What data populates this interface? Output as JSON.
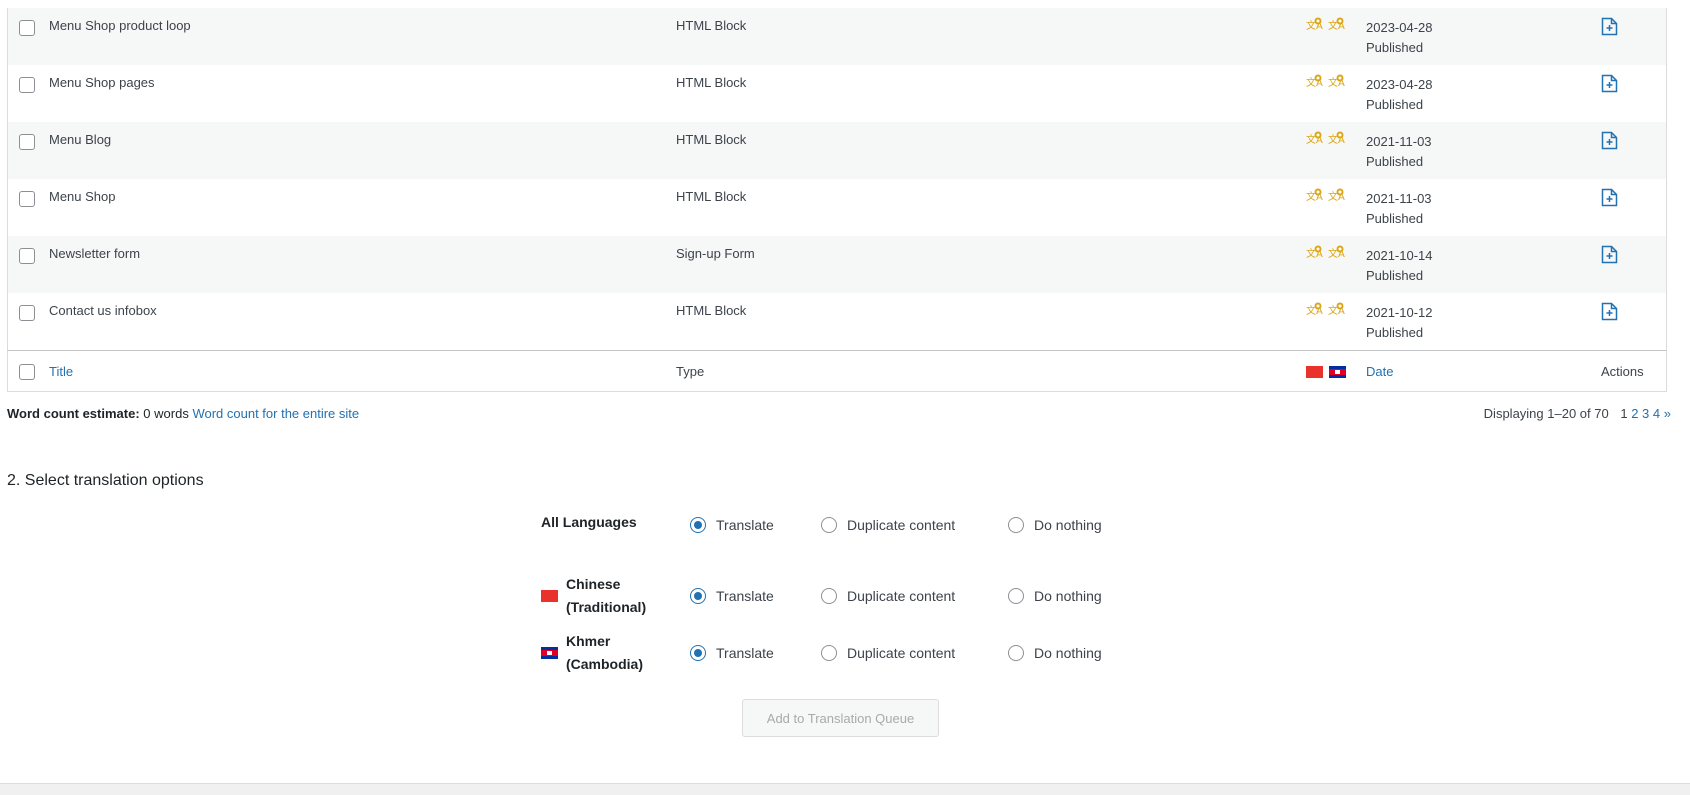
{
  "rows": [
    {
      "title": "Menu Shop product loop",
      "type": "HTML Block",
      "date": "2023-04-28",
      "status": "Published"
    },
    {
      "title": "Menu Shop pages",
      "type": "HTML Block",
      "date": "2023-04-28",
      "status": "Published"
    },
    {
      "title": "Menu Blog",
      "type": "HTML Block",
      "date": "2021-11-03",
      "status": "Published"
    },
    {
      "title": "Menu Shop",
      "type": "HTML Block",
      "date": "2021-11-03",
      "status": "Published"
    },
    {
      "title": "Newsletter form",
      "type": "Sign-up Form",
      "date": "2021-10-14",
      "status": "Published"
    },
    {
      "title": "Contact us infobox",
      "type": "HTML Block",
      "date": "2021-10-12",
      "status": "Published"
    }
  ],
  "footer": {
    "title": "Title",
    "type": "Type",
    "date": "Date",
    "actions": "Actions"
  },
  "word_count": {
    "label": "Word count estimate:",
    "value": "0 words",
    "link": "Word count for the entire site"
  },
  "pagination": {
    "display": "Displaying 1–20 of 70",
    "current": "1",
    "pages": [
      "2",
      "3",
      "4"
    ],
    "next": "»"
  },
  "section2": {
    "title": "2. Select translation options"
  },
  "options": {
    "translate": "Translate",
    "duplicate": "Duplicate content",
    "nothing": "Do nothing"
  },
  "languages": {
    "all": "All Languages",
    "chinese": "Chinese (Traditional)",
    "khmer": "Khmer (Cambodia)"
  },
  "queue_button": "Add to Translation Queue",
  "colors": {
    "accent": "#2271b1",
    "translation_icon": "#dba617"
  }
}
